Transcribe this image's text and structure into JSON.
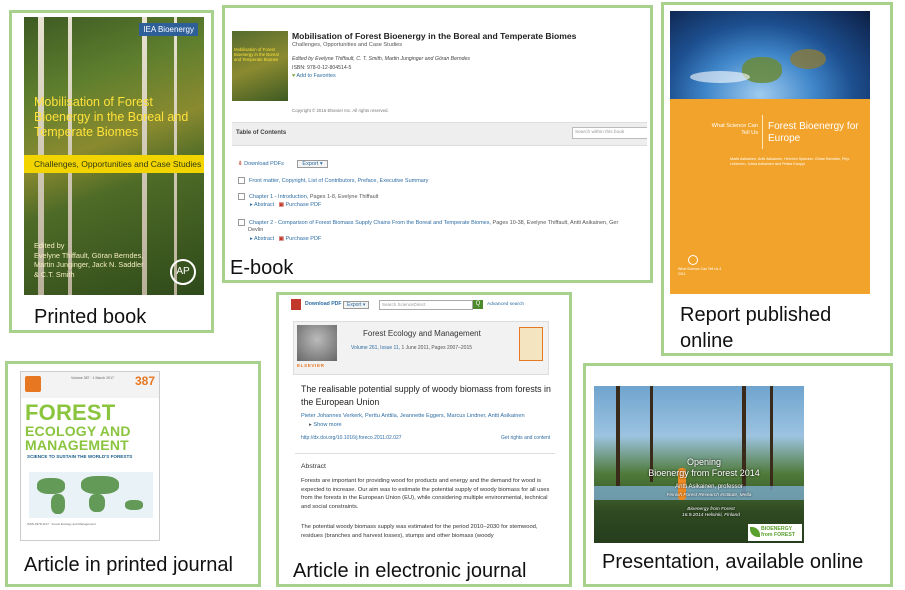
{
  "panels": {
    "printed_book": {
      "caption": "Printed book",
      "cover": {
        "publisher_badge": "IEA Bioenergy",
        "title": "Mobilisation of Forest Bioenergy in the Boreal and Temperate Biomes",
        "subtitle": "Challenges, Opportunities and Case Studies",
        "editors": [
          "Edited by",
          "Evelyne Thiffault, Göran Berndes,",
          "Martin Junginger, Jack N. Saddler",
          "& C.T. Smith"
        ],
        "logo": "AP"
      }
    },
    "ebook": {
      "caption": "E-book",
      "cover_text": "Mobilisation of Forest Bioenergy in the Boreal and Temperate Biomes",
      "title": "Mobilisation of Forest Bioenergy in the Boreal and Temperate Biomes",
      "subtitle": "Challenges, Opportunities and Case Studies",
      "authors": "Edited by Evelyne Thiffault, C. T. Smith, Martin Junginger and Göran Berndes",
      "isbn": "ISBN: 978-0-12-804514-5",
      "favorites": "Add to Favorites",
      "copyright": "Copyright © 2016 Elsevier Inc. All rights reserved.",
      "toc_label": "Table of Contents",
      "toc_search_placeholder": "Search within this book",
      "download_pdfs": "Download PDFs",
      "export": "Export",
      "front_matter": "Front matter,  Copyright,  List of Contributors,  Preface,  Executive Summary",
      "chapter1": "Chapter 1 - Introduction,",
      "chapter1_pages": "Pages 1-8, Evelyne Thiffault",
      "chapter2": "Chapter 2 - Comparison of Forest Biomass Supply Chains From the Boreal and Temperate Biomes,",
      "chapter2_pages": "Pages 10-38, Evelyne Thiffault, Antti Asikainen, Ger",
      "chapter2_more": "Devlin",
      "abstract_link": "Abstract",
      "purchase_pdf": "Purchase PDF"
    },
    "report": {
      "caption": "Report published online",
      "what_science": "What Science Can Tell Us",
      "title": "Forest Bioenergy for Europe",
      "authors": "Martti Asikainen, Antti Asikainen, Heinrich Spiecker, Göran Berndes, Pirjo Lehtonen, Jukka Asikainen and Pekka Kauppi",
      "series": "What Science Can Tell Us 4",
      "year": "2011"
    },
    "printed_journal": {
      "caption": "Article in printed journal",
      "issue": "387",
      "volume": "Volume 387 · 1 March 2017",
      "title_line1": "FOREST",
      "title_line2": "ECOLOGY AND",
      "title_line3": "MANAGEMENT",
      "tagline": "SCIENCE TO SUSTAIN THE WORLD'S FORESTS",
      "foot": "ISSN 0378-1127 · Forest Ecology and Management"
    },
    "ejournal": {
      "caption": "Article in electronic journal",
      "download_pdf": "Download PDF",
      "export": "Export",
      "search_placeholder": "Search ScienceDirect",
      "go": "Q",
      "advanced": "Advanced search",
      "publisher": "ELSEVIER",
      "journal": "Forest Ecology and Management",
      "volume_link": "Volume 261, Issue 11,",
      "volume_rest": "1 June 2011, Pages 2007–2015",
      "article_title": "The realisable potential supply of woody biomass from forests in the European Union",
      "authors": "Pieter Johannes Verkerk, Perttu Anttila, Jeannette Eggers, Marcus Lindner, Antti Asikainen",
      "show_more": "Show more",
      "doi": "http://dx.doi.org/10.1016/j.foreco.2011.02.027",
      "rights": "Get rights and content",
      "abstract_heading": "Abstract",
      "abstract_p1": "Forests are important for providing wood for products and energy and the demand for wood is expected to increase. Our aim was to estimate the potential supply of woody biomass for all uses from the forests in the European Union (EU), while considering multiple environmental, technical and social constraints.",
      "abstract_p2": "The potential woody biomass supply was estimated for the period 2010–2030 for stemwood, residues (branches and harvest losses), stumps and other biomass (woody"
    },
    "presentation": {
      "caption": "Presentation, available online",
      "title_line1": "Opening",
      "title_line2": "Bioenergy from Forest 2014",
      "speaker": "Antti Asikainen, professor",
      "institute": "Finnish Forest Research Institute, Metla",
      "event": "Bioenergy from Forest",
      "date_place": "16.9.2014 Helsinki, Finland",
      "logo_text_1": "BIOENERGY",
      "logo_text_2": "from FOREST"
    }
  },
  "colors": {
    "frame_border": "#a9d18e",
    "book_title": "#ffe23a",
    "report_orange": "#f2a32b",
    "journal_green": "#8bc53f",
    "link_blue": "#2e6da4"
  }
}
